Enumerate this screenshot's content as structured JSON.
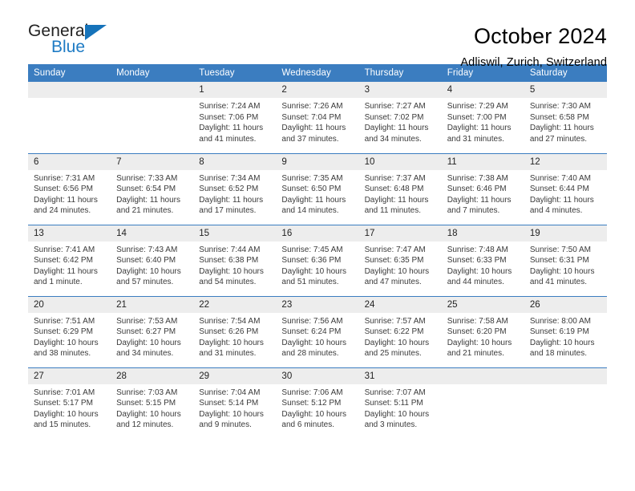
{
  "brand": {
    "name_part1": "General",
    "name_part2": "Blue",
    "accent_color": "#1673ba"
  },
  "header": {
    "title": "October 2024",
    "subtitle": "Adliswil, Zurich, Switzerland"
  },
  "theme": {
    "header_blue": "#3b7dc0",
    "daynum_gray": "#ededed"
  },
  "weekday_headers": [
    "Sunday",
    "Monday",
    "Tuesday",
    "Wednesday",
    "Thursday",
    "Friday",
    "Saturday"
  ],
  "weeks": [
    [
      {
        "day": "",
        "sunrise": "",
        "sunset": "",
        "daylight": "",
        "empty": true
      },
      {
        "day": "",
        "sunrise": "",
        "sunset": "",
        "daylight": "",
        "empty": true
      },
      {
        "day": "1",
        "sunrise": "Sunrise: 7:24 AM",
        "sunset": "Sunset: 7:06 PM",
        "daylight": "Daylight: 11 hours and 41 minutes."
      },
      {
        "day": "2",
        "sunrise": "Sunrise: 7:26 AM",
        "sunset": "Sunset: 7:04 PM",
        "daylight": "Daylight: 11 hours and 37 minutes."
      },
      {
        "day": "3",
        "sunrise": "Sunrise: 7:27 AM",
        "sunset": "Sunset: 7:02 PM",
        "daylight": "Daylight: 11 hours and 34 minutes."
      },
      {
        "day": "4",
        "sunrise": "Sunrise: 7:29 AM",
        "sunset": "Sunset: 7:00 PM",
        "daylight": "Daylight: 11 hours and 31 minutes."
      },
      {
        "day": "5",
        "sunrise": "Sunrise: 7:30 AM",
        "sunset": "Sunset: 6:58 PM",
        "daylight": "Daylight: 11 hours and 27 minutes."
      }
    ],
    [
      {
        "day": "6",
        "sunrise": "Sunrise: 7:31 AM",
        "sunset": "Sunset: 6:56 PM",
        "daylight": "Daylight: 11 hours and 24 minutes."
      },
      {
        "day": "7",
        "sunrise": "Sunrise: 7:33 AM",
        "sunset": "Sunset: 6:54 PM",
        "daylight": "Daylight: 11 hours and 21 minutes."
      },
      {
        "day": "8",
        "sunrise": "Sunrise: 7:34 AM",
        "sunset": "Sunset: 6:52 PM",
        "daylight": "Daylight: 11 hours and 17 minutes."
      },
      {
        "day": "9",
        "sunrise": "Sunrise: 7:35 AM",
        "sunset": "Sunset: 6:50 PM",
        "daylight": "Daylight: 11 hours and 14 minutes."
      },
      {
        "day": "10",
        "sunrise": "Sunrise: 7:37 AM",
        "sunset": "Sunset: 6:48 PM",
        "daylight": "Daylight: 11 hours and 11 minutes."
      },
      {
        "day": "11",
        "sunrise": "Sunrise: 7:38 AM",
        "sunset": "Sunset: 6:46 PM",
        "daylight": "Daylight: 11 hours and 7 minutes."
      },
      {
        "day": "12",
        "sunrise": "Sunrise: 7:40 AM",
        "sunset": "Sunset: 6:44 PM",
        "daylight": "Daylight: 11 hours and 4 minutes."
      }
    ],
    [
      {
        "day": "13",
        "sunrise": "Sunrise: 7:41 AM",
        "sunset": "Sunset: 6:42 PM",
        "daylight": "Daylight: 11 hours and 1 minute."
      },
      {
        "day": "14",
        "sunrise": "Sunrise: 7:43 AM",
        "sunset": "Sunset: 6:40 PM",
        "daylight": "Daylight: 10 hours and 57 minutes."
      },
      {
        "day": "15",
        "sunrise": "Sunrise: 7:44 AM",
        "sunset": "Sunset: 6:38 PM",
        "daylight": "Daylight: 10 hours and 54 minutes."
      },
      {
        "day": "16",
        "sunrise": "Sunrise: 7:45 AM",
        "sunset": "Sunset: 6:36 PM",
        "daylight": "Daylight: 10 hours and 51 minutes."
      },
      {
        "day": "17",
        "sunrise": "Sunrise: 7:47 AM",
        "sunset": "Sunset: 6:35 PM",
        "daylight": "Daylight: 10 hours and 47 minutes."
      },
      {
        "day": "18",
        "sunrise": "Sunrise: 7:48 AM",
        "sunset": "Sunset: 6:33 PM",
        "daylight": "Daylight: 10 hours and 44 minutes."
      },
      {
        "day": "19",
        "sunrise": "Sunrise: 7:50 AM",
        "sunset": "Sunset: 6:31 PM",
        "daylight": "Daylight: 10 hours and 41 minutes."
      }
    ],
    [
      {
        "day": "20",
        "sunrise": "Sunrise: 7:51 AM",
        "sunset": "Sunset: 6:29 PM",
        "daylight": "Daylight: 10 hours and 38 minutes."
      },
      {
        "day": "21",
        "sunrise": "Sunrise: 7:53 AM",
        "sunset": "Sunset: 6:27 PM",
        "daylight": "Daylight: 10 hours and 34 minutes."
      },
      {
        "day": "22",
        "sunrise": "Sunrise: 7:54 AM",
        "sunset": "Sunset: 6:26 PM",
        "daylight": "Daylight: 10 hours and 31 minutes."
      },
      {
        "day": "23",
        "sunrise": "Sunrise: 7:56 AM",
        "sunset": "Sunset: 6:24 PM",
        "daylight": "Daylight: 10 hours and 28 minutes."
      },
      {
        "day": "24",
        "sunrise": "Sunrise: 7:57 AM",
        "sunset": "Sunset: 6:22 PM",
        "daylight": "Daylight: 10 hours and 25 minutes."
      },
      {
        "day": "25",
        "sunrise": "Sunrise: 7:58 AM",
        "sunset": "Sunset: 6:20 PM",
        "daylight": "Daylight: 10 hours and 21 minutes."
      },
      {
        "day": "26",
        "sunrise": "Sunrise: 8:00 AM",
        "sunset": "Sunset: 6:19 PM",
        "daylight": "Daylight: 10 hours and 18 minutes."
      }
    ],
    [
      {
        "day": "27",
        "sunrise": "Sunrise: 7:01 AM",
        "sunset": "Sunset: 5:17 PM",
        "daylight": "Daylight: 10 hours and 15 minutes."
      },
      {
        "day": "28",
        "sunrise": "Sunrise: 7:03 AM",
        "sunset": "Sunset: 5:15 PM",
        "daylight": "Daylight: 10 hours and 12 minutes."
      },
      {
        "day": "29",
        "sunrise": "Sunrise: 7:04 AM",
        "sunset": "Sunset: 5:14 PM",
        "daylight": "Daylight: 10 hours and 9 minutes."
      },
      {
        "day": "30",
        "sunrise": "Sunrise: 7:06 AM",
        "sunset": "Sunset: 5:12 PM",
        "daylight": "Daylight: 10 hours and 6 minutes."
      },
      {
        "day": "31",
        "sunrise": "Sunrise: 7:07 AM",
        "sunset": "Sunset: 5:11 PM",
        "daylight": "Daylight: 10 hours and 3 minutes."
      },
      {
        "day": "",
        "sunrise": "",
        "sunset": "",
        "daylight": "",
        "empty": true
      },
      {
        "day": "",
        "sunrise": "",
        "sunset": "",
        "daylight": "",
        "empty": true
      }
    ]
  ]
}
